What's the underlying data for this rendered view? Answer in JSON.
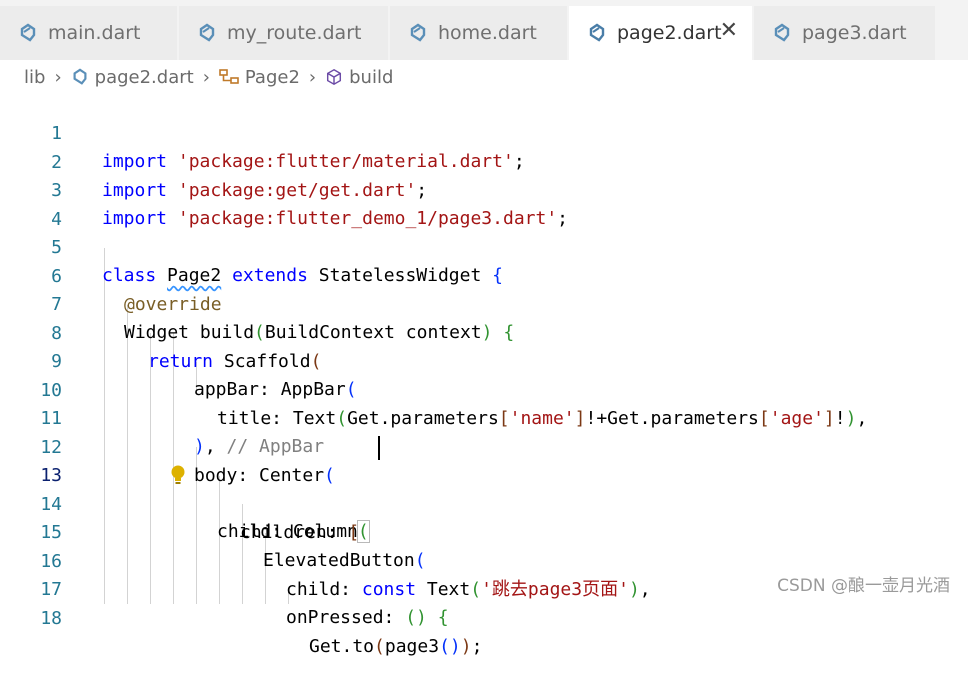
{
  "tabs": [
    {
      "label": "main.dart"
    },
    {
      "label": "my_route.dart"
    },
    {
      "label": "home.dart"
    },
    {
      "label": "page2.dart"
    },
    {
      "label": "page3.dart"
    }
  ],
  "active_tab": "page2.dart",
  "breadcrumb": {
    "root": "lib",
    "file": "page2.dart",
    "class": "Page2",
    "method": "build"
  },
  "colors": {
    "keyword": "#0000ff",
    "string": "#a31515",
    "comment": "#808080",
    "annotation": "#795e26",
    "line_number": "#237893"
  },
  "line_numbers": [
    "1",
    "2",
    "3",
    "4",
    "5",
    "6",
    "7",
    "8",
    "9",
    "10",
    "11",
    "12",
    "13",
    "14",
    "15",
    "16",
    "17",
    "18"
  ],
  "current_line": "13",
  "code": {
    "l1": [
      "import",
      " ",
      "'package:flutter/material.dart'",
      ";"
    ],
    "l2": [
      "import",
      " ",
      "'package:get/get.dart'",
      ";"
    ],
    "l3": [
      "import",
      " ",
      "'package:flutter_demo_1/page3.dart'",
      ";"
    ],
    "l5": [
      "class",
      " ",
      "Page2",
      " ",
      "extends",
      " StatelessWidget ",
      "{"
    ],
    "l6": [
      "@override"
    ],
    "l7": [
      "Widget build",
      "(",
      "BuildContext context",
      ")",
      " ",
      "{"
    ],
    "l8": [
      "return",
      " Scaffold",
      "("
    ],
    "l9": [
      "appBar: AppBar",
      "("
    ],
    "l10": [
      "title: Text",
      "(",
      "Get.parameters",
      "[",
      "'name'",
      "]",
      "!+Get.parameters",
      "[",
      "'age'",
      "]",
      "!",
      ")",
      ","
    ],
    "l11": [
      ")",
      ", ",
      "// AppBar"
    ],
    "l12": [
      "body: Center",
      "("
    ],
    "l13": [
      "child: Column",
      "("
    ],
    "l14": [
      "children: ",
      "["
    ],
    "l15": [
      "ElevatedButton",
      "("
    ],
    "l16": [
      "child: ",
      "const",
      " Text",
      "(",
      "'跳去page3页面'",
      ")",
      ","
    ],
    "l17": [
      "onPressed: ",
      "()",
      " ",
      "{"
    ],
    "l18": [
      "Get.to",
      "(",
      "page3",
      "()",
      ")",
      ";"
    ]
  },
  "watermark": "CSDN @酿一壶月光酒"
}
